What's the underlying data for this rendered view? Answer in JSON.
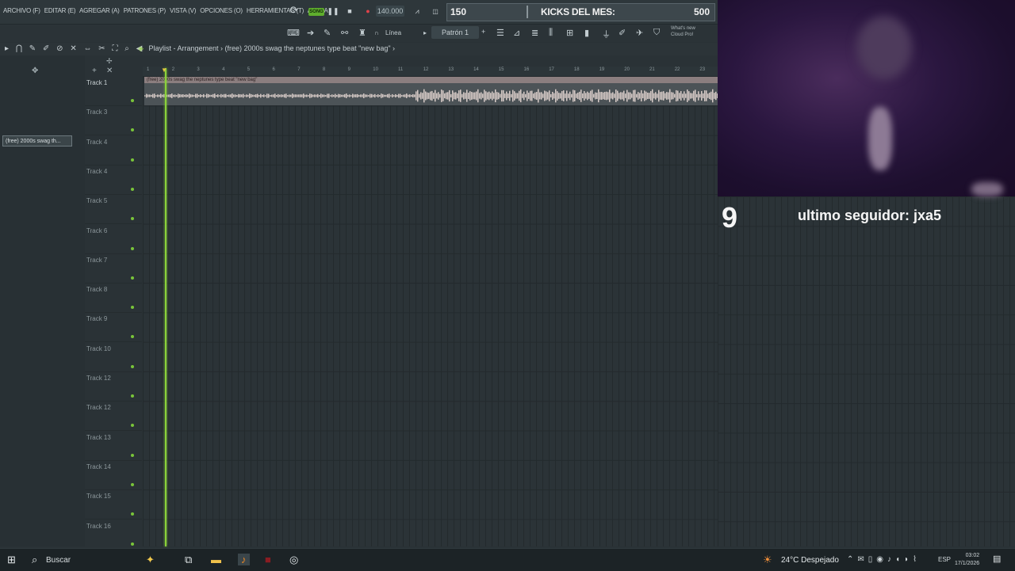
{
  "menu": [
    "ARCHIVO (F)",
    "EDITAR (E)",
    "AGREGAR (A)",
    "PATRONES (P)",
    "VISTA (V)",
    "OPCIONES (O)",
    "HERRAMIENTAS (T)",
    "AYUDA"
  ],
  "transport": {
    "song_label": "SONG",
    "tempo": "140.000"
  },
  "overlay": {
    "left_value": "150",
    "middle_text": "KICKS DEL MES:",
    "right_value": "500"
  },
  "toolbar2": {
    "snap_label": "Línea",
    "pattern": "Patrón 1",
    "news_line1": "What's new",
    "news_line2": "Cloud Pro!"
  },
  "playlist": {
    "title": "Playlist - Arrangement",
    "clip": "(free) 2000s swag  the neptunes type beat  \"new bag\""
  },
  "picker": {
    "clip_item": "(free) 2000s swag  th..."
  },
  "clip_label": "(free) 2000s swag  the neptunes type beat  \"new bag\"",
  "tracks": [
    "Track 1",
    "Track 3",
    "Track 4",
    "Track 4",
    "Track 5",
    "Track 6",
    "Track 7",
    "Track 8",
    "Track 9",
    "Track 10",
    "Track 12",
    "Track 12",
    "Track 13",
    "Track 14",
    "Track 15",
    "Track 16"
  ],
  "timeline_ticks": [
    "1",
    "2",
    "3",
    "4",
    "5",
    "6",
    "7",
    "8",
    "9",
    "10",
    "11",
    "12",
    "13",
    "14",
    "15",
    "16",
    "17",
    "18",
    "19",
    "20",
    "21",
    "22",
    "23"
  ],
  "stream": {
    "sub_count": "9",
    "last_follower": "ultimo seguidor: jxa5"
  },
  "taskbar": {
    "search": "Buscar",
    "weather": "24°C  Despejado",
    "lang": "ESP",
    "time": "03:02",
    "date": "17/1/2026"
  },
  "colors": {
    "playhead": "#8bd23a",
    "song_toggle": "#5fae2d",
    "record": "#e0424a",
    "clip_header": "#8b7e7f"
  }
}
